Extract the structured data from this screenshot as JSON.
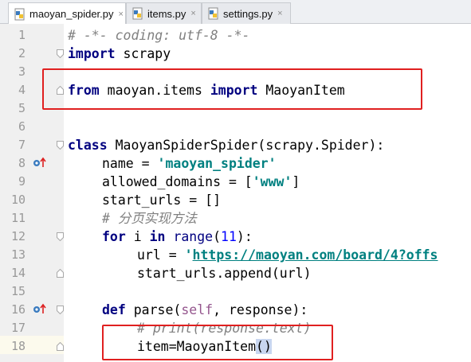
{
  "tabs": [
    {
      "name": "maoyan_spider.py",
      "active": true
    },
    {
      "name": "items.py",
      "active": false
    },
    {
      "name": "settings.py",
      "active": false
    }
  ],
  "tab_close": "×",
  "line_numbers": [
    "1",
    "2",
    "3",
    "4",
    "5",
    "6",
    "7",
    "8",
    "9",
    "10",
    "11",
    "12",
    "13",
    "14",
    "15",
    "16",
    "17",
    "18"
  ],
  "code": {
    "l1": "# -*- coding: utf-8 -*-",
    "l2_kw": "import",
    "l2_rest": " scrapy",
    "l4_kw1": "from",
    "l4_mid": " maoyan.items ",
    "l4_kw2": "import",
    "l4_rest": " MaoyanItem",
    "l7_kw": "class",
    "l7_rest": " MaoyanSpiderSpider(scrapy.Spider):",
    "l8_a": "name = ",
    "l8_str": "'maoyan_spider'",
    "l9_a": "allowed_domains = [",
    "l9_str": "'www'",
    "l9_b": "]",
    "l10": "start_urls = []",
    "l11": "# 分页实现方法",
    "l12_for": "for",
    "l12_i": " i ",
    "l12_in": "in",
    "l12_sp": " ",
    "l12_range": "range",
    "l12_open": "(",
    "l12_num": "11",
    "l12_close": "):",
    "l13_a": "url = ",
    "l13_q": "'",
    "l13_url": "https://maoyan.com/board/4?offs",
    "l14": "start_urls.append(url)",
    "l16_def": "def",
    "l16_a": " parse(",
    "l16_self": "self",
    "l16_b": ", response):",
    "l17": "# print(response.text)",
    "l18_a": "item=MaoyanItem",
    "l18_paren": "()"
  },
  "colors": {
    "keyword": "#000080",
    "string": "#008080",
    "comment": "#808080",
    "annotation_box": "#e02020"
  },
  "icons": [
    "python-file-icon",
    "close-icon",
    "fold-icon",
    "override-marker-icon",
    "lightbulb-icon"
  ]
}
